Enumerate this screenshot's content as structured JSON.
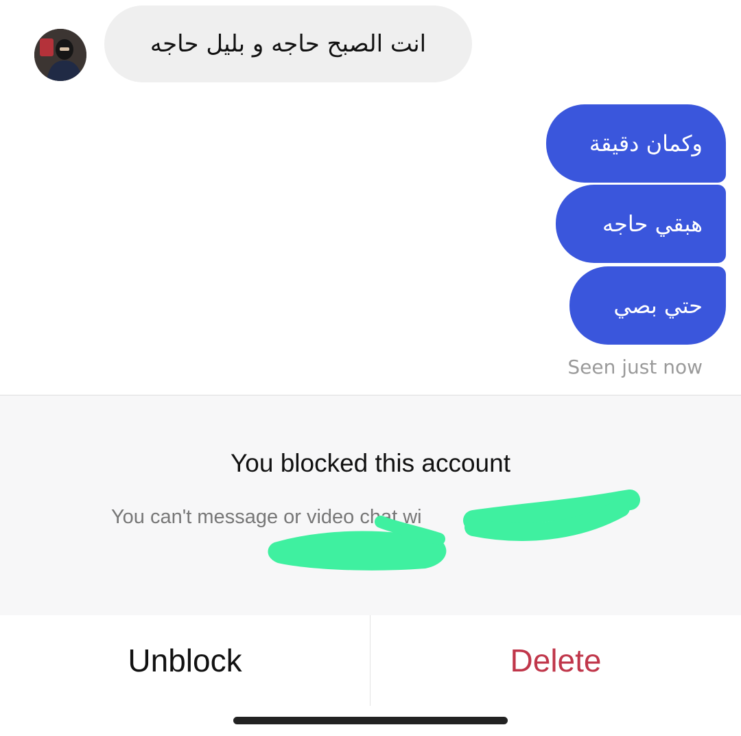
{
  "thread": {
    "incoming": [
      {
        "text": "انت الصبح حاجه و بليل حاجه"
      }
    ],
    "outgoing": [
      {
        "text": "وكمان دقيقة"
      },
      {
        "text": "هبقي حاجه"
      },
      {
        "text": "حتي بصي"
      }
    ],
    "seen_status": "Seen just now"
  },
  "blocked": {
    "title": "You blocked this account",
    "subtitle": "You can't message or video chat wi"
  },
  "actions": {
    "unblock_label": "Unblock",
    "delete_label": "Delete"
  },
  "colors": {
    "outgoing_bubble": "#3a56dc",
    "incoming_bubble": "#efefef",
    "delete_text": "#c0364a",
    "redaction_marker": "#3ff0a0"
  }
}
